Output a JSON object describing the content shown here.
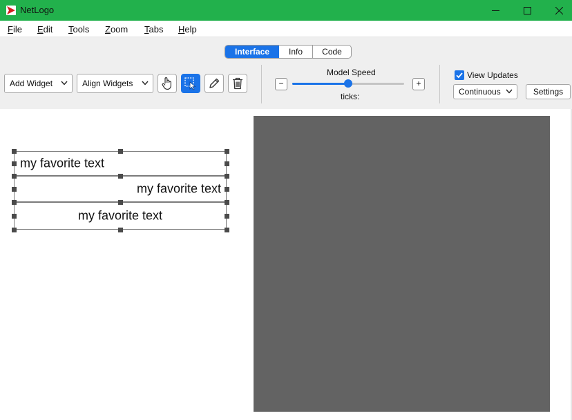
{
  "window": {
    "title": "NetLogo",
    "controls": {
      "minimize": "minimize-icon",
      "maximize": "maximize-icon",
      "close": "close-icon"
    }
  },
  "menu": {
    "items": [
      {
        "mnemonic": "F",
        "rest": "ile"
      },
      {
        "mnemonic": "E",
        "rest": "dit"
      },
      {
        "mnemonic": "T",
        "rest": "ools"
      },
      {
        "mnemonic": "Z",
        "rest": "oom"
      },
      {
        "mnemonic": "T",
        "rest": "abs"
      },
      {
        "mnemonic": "H",
        "rest": "elp"
      }
    ]
  },
  "tabs": {
    "items": [
      "Interface",
      "Info",
      "Code"
    ],
    "selected": "Interface"
  },
  "toolbar": {
    "add_widget": "Add Widget",
    "align_widgets": "Align Widgets",
    "tools": [
      "interact-hand-icon",
      "select-widgets-icon",
      "edit-pencil-icon",
      "delete-trash-icon"
    ],
    "active_tool": "select-widgets-icon"
  },
  "speed": {
    "label": "Model Speed",
    "ticks_label": "ticks:",
    "minus": "−",
    "plus": "+",
    "value_fraction": 0.5
  },
  "view_updates": {
    "label": "View Updates",
    "checked": true,
    "mode": "Continuous",
    "settings": "Settings"
  },
  "notes": [
    {
      "text": "my favorite text",
      "align": "left"
    },
    {
      "text": "my favorite text",
      "align": "right"
    },
    {
      "text": "my favorite text",
      "align": "center"
    }
  ],
  "colors": {
    "titlebar": "#22b14c",
    "accent": "#1a73e8",
    "world_view": "#636363",
    "toolbar_bg": "#efefef"
  }
}
